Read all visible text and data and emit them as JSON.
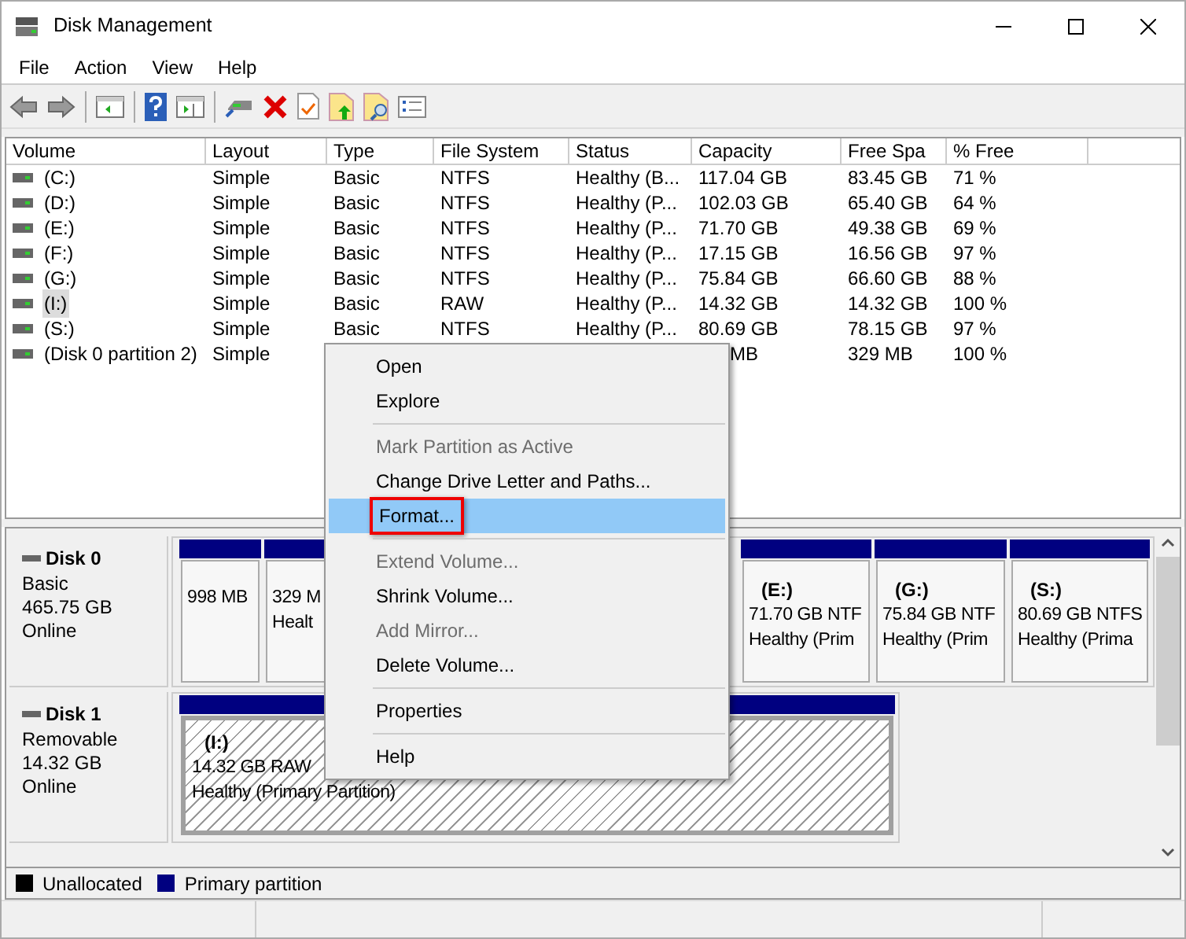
{
  "window": {
    "title": "Disk Management"
  },
  "menu_bar": [
    "File",
    "Action",
    "View",
    "Help"
  ],
  "volume_table": {
    "columns": [
      "Volume",
      "Layout",
      "Type",
      "File System",
      "Status",
      "Capacity",
      "Free Spa",
      "% Free"
    ],
    "rows": [
      {
        "volume": "(C:)",
        "layout": "Simple",
        "type": "Basic",
        "file_system": "NTFS",
        "status": "Healthy (B...",
        "capacity": "117.04 GB",
        "free_space": "83.45 GB",
        "percent_free": "71 %",
        "selected": false
      },
      {
        "volume": "(D:)",
        "layout": "Simple",
        "type": "Basic",
        "file_system": "NTFS",
        "status": "Healthy (P...",
        "capacity": "102.03 GB",
        "free_space": "65.40 GB",
        "percent_free": "64 %",
        "selected": false
      },
      {
        "volume": "(E:)",
        "layout": "Simple",
        "type": "Basic",
        "file_system": "NTFS",
        "status": "Healthy (P...",
        "capacity": "71.70 GB",
        "free_space": "49.38 GB",
        "percent_free": "69 %",
        "selected": false
      },
      {
        "volume": "(F:)",
        "layout": "Simple",
        "type": "Basic",
        "file_system": "NTFS",
        "status": "Healthy (P...",
        "capacity": "17.15 GB",
        "free_space": "16.56 GB",
        "percent_free": "97 %",
        "selected": false
      },
      {
        "volume": "(G:)",
        "layout": "Simple",
        "type": "Basic",
        "file_system": "NTFS",
        "status": "Healthy (P...",
        "capacity": "75.84 GB",
        "free_space": "66.60 GB",
        "percent_free": "88 %",
        "selected": false
      },
      {
        "volume": "(I:)",
        "layout": "Simple",
        "type": "Basic",
        "file_system": "RAW",
        "status": "Healthy (P...",
        "capacity": "14.32 GB",
        "free_space": "14.32 GB",
        "percent_free": "100 %",
        "selected": true
      },
      {
        "volume": "(S:)",
        "layout": "Simple",
        "type": "Basic",
        "file_system": "NTFS",
        "status": "Healthy (P...",
        "capacity": "80.69 GB",
        "free_space": "78.15 GB",
        "percent_free": "97 %",
        "selected": false
      },
      {
        "volume": "(Disk 0 partition 2)",
        "layout": "Simple",
        "capacity": "MB",
        "free_space": "329 MB",
        "percent_free": "100 %",
        "selected": false
      }
    ]
  },
  "disks": [
    {
      "name": "Disk 0",
      "lines": [
        "Basic",
        "465.75 GB",
        "Online"
      ],
      "partitions": [
        {
          "lines": [
            "998 MB"
          ],
          "selected": false
        },
        {
          "lines": [
            "329 M",
            "Healt"
          ],
          "selected": false
        },
        {
          "label": "(E:)",
          "lines": [
            "71.70 GB NTF",
            "Healthy (Prim"
          ],
          "selected": false
        },
        {
          "label": "(G:)",
          "lines": [
            "75.84 GB NTF",
            "Healthy (Prim"
          ],
          "selected": false
        },
        {
          "label": "(S:)",
          "lines": [
            "80.69 GB NTFS",
            "Healthy (Prima"
          ],
          "selected": false
        }
      ]
    },
    {
      "name": "Disk 1",
      "lines": [
        "Removable",
        "14.32 GB",
        "Online"
      ],
      "partitions": [
        {
          "label": "(I:)",
          "lines": [
            "14.32 GB RAW",
            "Healthy (Primary Partition)"
          ],
          "selected": true
        }
      ]
    }
  ],
  "legend": [
    {
      "label": "Unallocated",
      "color": "#000000"
    },
    {
      "label": "Primary partition",
      "color": "#000080"
    }
  ],
  "context_menu": [
    {
      "kind": "item",
      "label": "Open",
      "disabled": false,
      "selected": false
    },
    {
      "kind": "item",
      "label": "Explore",
      "disabled": false,
      "selected": false
    },
    {
      "kind": "separator"
    },
    {
      "kind": "item",
      "label": "Mark Partition as Active",
      "disabled": true,
      "selected": false
    },
    {
      "kind": "item",
      "label": "Change Drive Letter and Paths...",
      "disabled": false,
      "selected": false
    },
    {
      "kind": "item",
      "label": "Format...",
      "disabled": false,
      "selected": true
    },
    {
      "kind": "separator"
    },
    {
      "kind": "item",
      "label": "Extend Volume...",
      "disabled": true,
      "selected": false
    },
    {
      "kind": "item",
      "label": "Shrink Volume...",
      "disabled": false,
      "selected": false
    },
    {
      "kind": "item",
      "label": "Add Mirror...",
      "disabled": true,
      "selected": false
    },
    {
      "kind": "item",
      "label": "Delete Volume...",
      "disabled": false,
      "selected": false
    },
    {
      "kind": "separator"
    },
    {
      "kind": "item",
      "label": "Properties",
      "disabled": false,
      "selected": false
    },
    {
      "kind": "separator"
    },
    {
      "kind": "item",
      "label": "Help",
      "disabled": false,
      "selected": false
    }
  ]
}
